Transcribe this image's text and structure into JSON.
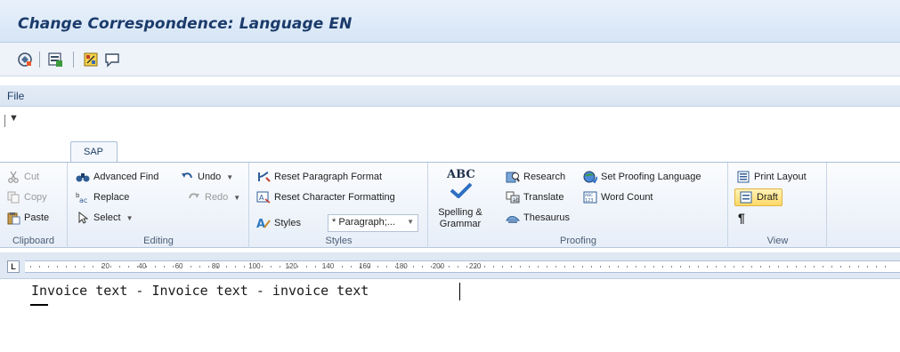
{
  "window": {
    "title": "Change Correspondence: Language EN"
  },
  "sap_toolbar": {
    "icons": [
      "display-change-icon",
      "insert-object-icon",
      "local-file-icon",
      "comment-icon"
    ]
  },
  "word": {
    "file_menu": "File",
    "tab": "SAP",
    "ribbon": {
      "clipboard": {
        "label": "Clipboard",
        "cut": "Cut",
        "copy": "Copy",
        "paste": "Paste"
      },
      "editing": {
        "label": "Editing",
        "advanced_find": "Advanced Find",
        "replace": "Replace",
        "select": "Select",
        "undo": "Undo",
        "redo": "Redo"
      },
      "styles": {
        "label": "Styles",
        "reset_paragraph": "Reset Paragraph Format",
        "reset_character": "Reset Character Formatting",
        "styles": "Styles",
        "style_combo": "* Paragraph;..."
      },
      "proofing": {
        "label": "Proofing",
        "spelling": "Spelling &",
        "grammar": "Grammar",
        "abc": "ABC",
        "research": "Research",
        "set_proofing": "Set Proofing Language",
        "translate": "Translate",
        "word_count": "Word Count",
        "thesaurus": "Thesaurus"
      },
      "view": {
        "label": "View",
        "print_layout": "Print Layout",
        "draft": "Draft",
        "pilcrow": "¶"
      }
    },
    "ruler": {
      "marks": [
        "20",
        "40",
        "60",
        "80",
        "100",
        "120",
        "140",
        "160",
        "180",
        "200",
        "220"
      ]
    },
    "document": {
      "text": "Invoice text - Invoice text - invoice text"
    }
  },
  "colors": {
    "title": "#1b3b6b",
    "accent": "#ffd966"
  }
}
